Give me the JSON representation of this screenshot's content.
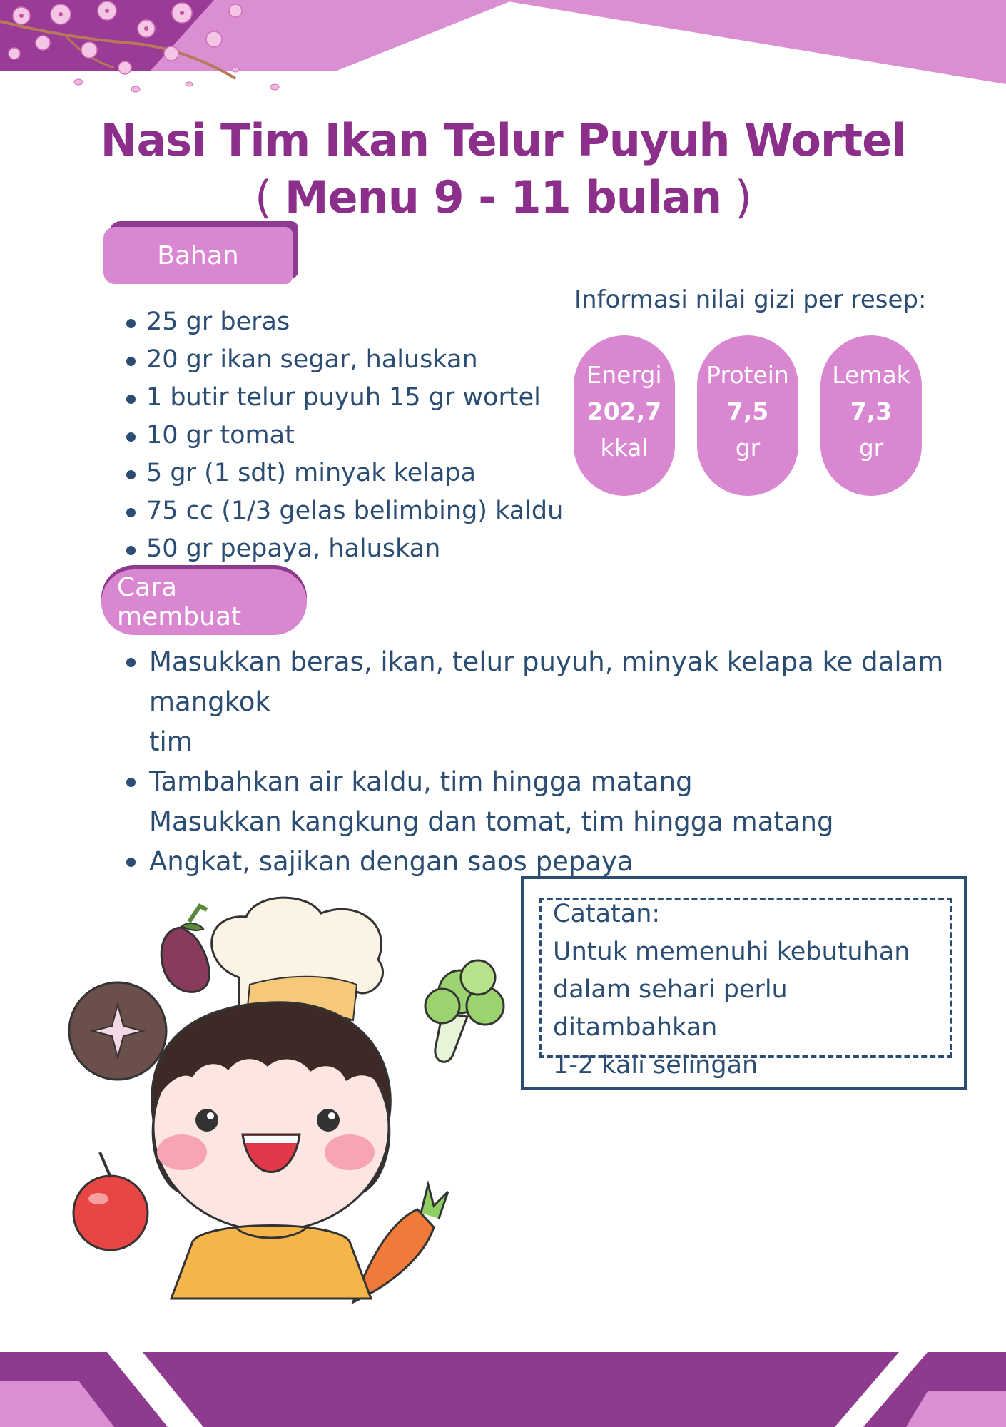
{
  "title": {
    "line1": "Nasi Tim Ikan Telur Puyuh Wortel",
    "line2_open": "( ",
    "line2_text": "Menu  9 - 11 bulan",
    "line2_close": " )"
  },
  "bahan": {
    "heading": "Bahan",
    "items": [
      "25 gr beras",
      "20 gr ikan segar, haluskan",
      "1 butir telur puyuh 15 gr wortel",
      "10 gr tomat",
      "5 gr (1 sdt) minyak kelapa",
      "75 cc (1/3 gelas belimbing) kaldu",
      "50 gr pepaya, haluskan"
    ]
  },
  "gizi": {
    "heading": "Informasi nilai gizi per resep:",
    "items": [
      {
        "label": "Energi",
        "value": "202,7",
        "unit": "kkal"
      },
      {
        "label": "Protein",
        "value": "7,5",
        "unit": "gr"
      },
      {
        "label": "Lemak",
        "value": "7,3",
        "unit": "gr"
      }
    ]
  },
  "cara": {
    "heading": "Cara membuat",
    "steps": [
      "Masukkan beras, ikan, telur puyuh, minyak kelapa ke dalam mangkok",
      "tim",
      "Tambahkan air kaldu, tim hingga matang",
      "Masukkan kangkung dan tomat, tim hingga matang",
      "Angkat, sajikan dengan saos pepaya"
    ]
  },
  "catatan": {
    "line1": "Catatan:",
    "line2": "Untuk memenuhi kebutuhan",
    "line3": "dalam sehari perlu ditambahkan",
    "line4": "1-2 kali selingan"
  },
  "colors": {
    "title": "#8b2f8b",
    "accent_pink": "#d887d0",
    "accent_purple": "#8e3a8e",
    "text_blue": "#2b4d73"
  },
  "illustration": {
    "icons": [
      "cherry-blossom-icon",
      "chef-girl-icon",
      "eggplant-icon",
      "mushroom-icon",
      "broccoli-icon",
      "tomato-icon",
      "carrot-icon"
    ]
  }
}
